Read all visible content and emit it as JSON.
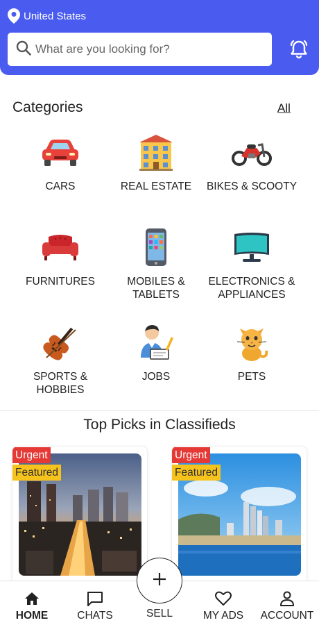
{
  "header": {
    "location": "United States",
    "search_placeholder": "What are you looking for?",
    "accent_color": "#4a5cf0"
  },
  "categories": {
    "title": "Categories",
    "all_link": "All",
    "items": [
      {
        "label": "CARS",
        "icon": "car-icon"
      },
      {
        "label": "REAL ESTATE",
        "icon": "building-icon"
      },
      {
        "label": "BIKES & SCOOTY",
        "icon": "motorbike-icon"
      },
      {
        "label": "FURNITURES",
        "icon": "sofa-icon"
      },
      {
        "label": "MOBILES &\nTABLETS",
        "icon": "mobile-phone-icon"
      },
      {
        "label": "ELECTRONICS &\nAPPLIANCES",
        "icon": "monitor-icon"
      },
      {
        "label": "SPORTS &\nHOBBIES",
        "icon": "violin-icon"
      },
      {
        "label": "JOBS",
        "icon": "worker-icon"
      },
      {
        "label": "PETS",
        "icon": "cat-icon"
      }
    ]
  },
  "top_picks": {
    "title": "Top Picks in Classifieds",
    "cards": [
      {
        "badges": [
          "Urgent",
          "Featured"
        ],
        "image": "city-night-photo"
      },
      {
        "badges": [
          "Urgent",
          "Featured"
        ],
        "image": "city-skyline-sea-photo"
      }
    ]
  },
  "bottom_nav": {
    "items": [
      {
        "label": "HOME",
        "icon": "home-icon",
        "active": true
      },
      {
        "label": "CHATS",
        "icon": "chat-icon",
        "active": false
      },
      {
        "label": "SELL",
        "icon": "plus-icon",
        "active": false
      },
      {
        "label": "MY ADS",
        "icon": "heart-icon",
        "active": false
      },
      {
        "label": "ACCOUNT",
        "icon": "person-icon",
        "active": false
      }
    ]
  },
  "colors": {
    "urgent": "#e53935",
    "featured": "#f6c21c"
  }
}
